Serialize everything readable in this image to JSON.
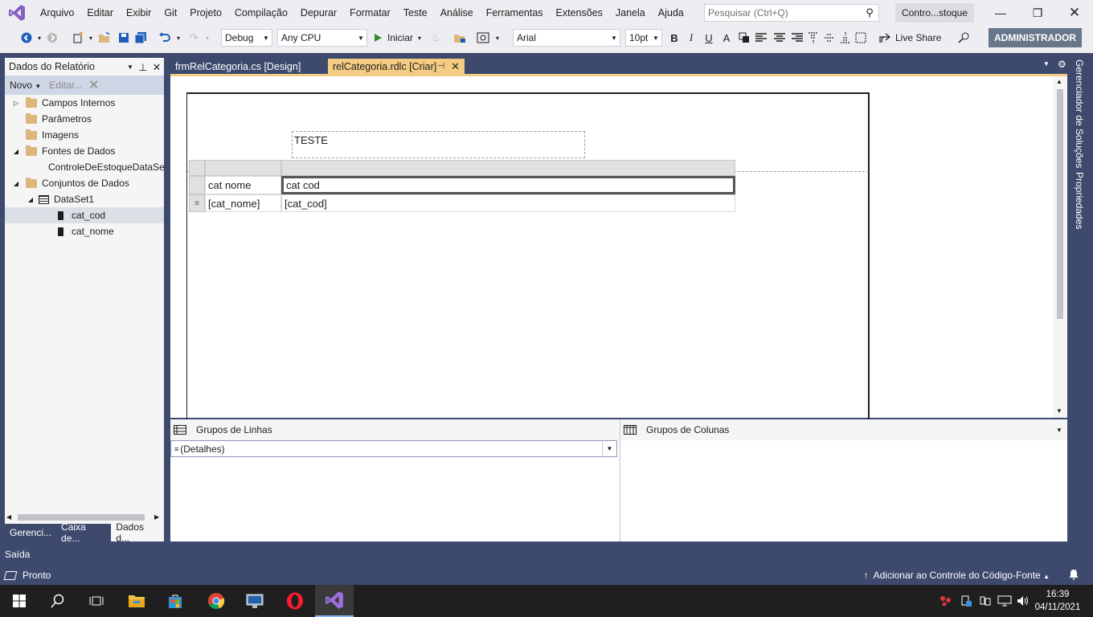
{
  "menu": {
    "items": [
      "Arquivo",
      "Editar",
      "Exibir",
      "Git",
      "Projeto",
      "Compilação",
      "Depurar",
      "Formatar",
      "Teste",
      "Análise",
      "Ferramentas",
      "Extensões",
      "Janela",
      "Ajuda"
    ]
  },
  "search": {
    "placeholder": "Pesquisar (Ctrl+Q)"
  },
  "solution": {
    "name": "Contro...stoque"
  },
  "toolbar": {
    "config": "Debug",
    "platform": "Any CPU",
    "start_label": "Iniciar",
    "font_name": "Arial",
    "font_size": "10pt",
    "live_share": "Live Share",
    "admin_label": "ADMINISTRADOR"
  },
  "left_panel": {
    "title": "Dados do Relatório",
    "new_label": "Novo",
    "edit_label": "Editar...",
    "tree": [
      {
        "label": "Campos Internos"
      },
      {
        "label": "Parâmetros"
      },
      {
        "label": "Imagens"
      },
      {
        "label": "Fontes de Dados"
      },
      {
        "label": "ControleDeEstoqueDataSet"
      },
      {
        "label": "Conjuntos de Dados"
      },
      {
        "label": "DataSet1"
      },
      {
        "label": "cat_cod"
      },
      {
        "label": "cat_nome"
      }
    ],
    "tabs": [
      "Gerenci...",
      "Caixa de...",
      "Dados d..."
    ]
  },
  "doc_tabs": [
    {
      "label": "frmRelCategoria.cs [Design]"
    },
    {
      "label": "relCategoria.rdlc [Criar]"
    }
  ],
  "report": {
    "title_text": "TESTE",
    "header_cells": [
      "cat nome",
      "cat cod"
    ],
    "detail_cells": [
      "[cat_nome]",
      "[cat_cod]"
    ]
  },
  "groups": {
    "row_title": "Grupos de Linhas",
    "col_title": "Grupos de Colunas",
    "details": "(Detalhes)"
  },
  "right_tabs": [
    "Gerenciador de Soluções",
    "Propriedades"
  ],
  "output": {
    "label": "Saída"
  },
  "status": {
    "left": "Pronto",
    "right": "Adicionar ao Controle do Código-Fonte"
  },
  "taskbar": {
    "time": "16:39",
    "date": "04/11/2021"
  },
  "colors": {
    "accent": "#68768a",
    "tab_active": "#f5cc84",
    "frame": "#3d4a6d"
  }
}
